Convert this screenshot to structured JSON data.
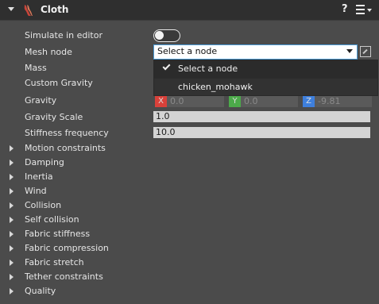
{
  "header": {
    "title": "Cloth",
    "help": "?"
  },
  "properties": {
    "simulate_in_editor": "Simulate in editor",
    "mesh_node": "Mesh node",
    "mass": "Mass",
    "custom_gravity": "Custom Gravity",
    "gravity": "Gravity",
    "gravity_scale": "Gravity Scale",
    "stiffness_frequency": "Stiffness frequency"
  },
  "mesh_node_select": {
    "value": "Select a node",
    "options": [
      "Select a node",
      "chicken_mohawk"
    ]
  },
  "gravity": {
    "x_tag": "X",
    "x": "0.0",
    "y_tag": "Y",
    "y": "0.0",
    "z_tag": "Z",
    "z": "-9.81",
    "x_color": "#d9413a",
    "y_color": "#4caa4a",
    "z_color": "#3e7fdc"
  },
  "gravity_scale": "1.0",
  "stiffness_frequency": "10.0",
  "groups": [
    "Motion constraints",
    "Damping",
    "Inertia",
    "Wind",
    "Collision",
    "Self collision",
    "Fabric stiffness",
    "Fabric compression",
    "Fabric stretch",
    "Tether constraints",
    "Quality"
  ],
  "icons": {
    "collapse": "chevron-down-icon",
    "component": "cloth-icon",
    "menu": "hamburger-menu-icon",
    "picker": "entity-picker-icon",
    "check": "check-icon"
  },
  "colors": {
    "header_bg": "#2f2f2f",
    "panel_bg": "#4b4b4b",
    "accent": "#4a9bd6",
    "component_icon": "#c9453a"
  }
}
